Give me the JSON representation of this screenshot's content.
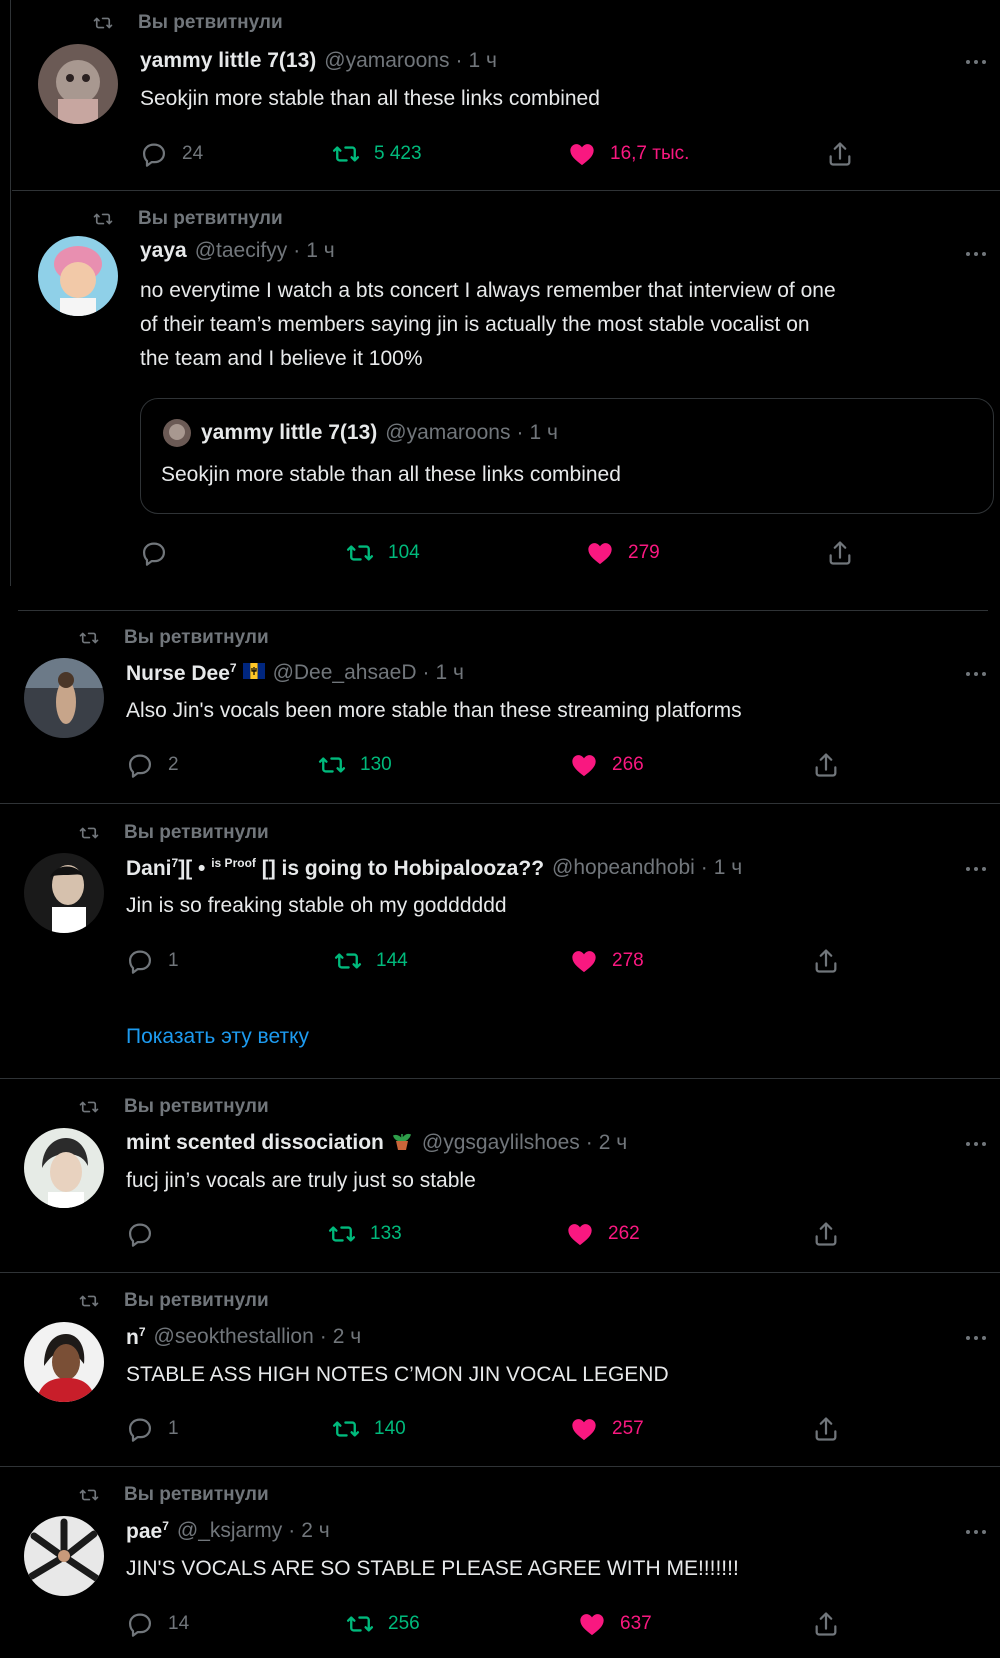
{
  "retweet_label": "Вы ретвитнули",
  "show_thread": "Показать эту ветку",
  "colors": {
    "retweet": "#00ba7c",
    "like": "#f91880",
    "muted": "#71767b",
    "link": "#1d9bf0"
  },
  "tweets": [
    {
      "name": "yammy little 7(13)",
      "handle": "@yamaroons",
      "time": "1 ч",
      "text": "Seokjin more stable than all these links combined",
      "replies": "24",
      "retweets": "5 423",
      "likes": "16,7 тыс."
    },
    {
      "name": "yaya",
      "handle": "@taecifyy",
      "time": "1 ч",
      "text_lines": [
        "no everytime I watch a bts concert I always remember that interview of one",
        "of their team’s members saying jin is actually the most stable vocalist on",
        "the team and I believe it 100%"
      ],
      "quote": {
        "name": "yammy little 7(13)",
        "handle": "@yamaroons",
        "time": "1 ч",
        "text": "Seokjin more stable than all these links combined"
      },
      "replies": "",
      "retweets": "104",
      "likes": "279"
    },
    {
      "name": "Nurse Dee",
      "name_sup": "7",
      "handle": "@Dee_ahsaeD",
      "time": "1 ч",
      "text": "Also Jin's vocals been more stable than these streaming platforms",
      "replies": "2",
      "retweets": "130",
      "likes": "266"
    },
    {
      "name": "Dani",
      "name_sup": "7",
      "name_rest": "][ • ",
      "name_sup2": "is Proof",
      "name_tail": " [] is going to Hobipalooza??",
      "handle": "@hopeandhobi",
      "time": "1 ч",
      "text": "Jin is so freaking stable oh my godddddd",
      "replies": "1",
      "retweets": "144",
      "likes": "278"
    },
    {
      "name": "mint scented dissociation",
      "name_emoji": "🪴",
      "handle": "@ygsgaylilshoes",
      "time": "2 ч",
      "text": "fucj jin’s vocals are truly just so stable",
      "replies": "",
      "retweets": "133",
      "likes": "262"
    },
    {
      "name": "n",
      "name_sup": "7",
      "handle": "@seokthestallion",
      "time": "2 ч",
      "text": "STABLE ASS HIGH NOTES C’MON JIN VOCAL LEGEND",
      "replies": "1",
      "retweets": "140",
      "likes": "257"
    },
    {
      "name": "pae",
      "name_sup": "7",
      "handle": "@_ksjarmy",
      "time": "2 ч",
      "text": "JIN'S VOCALS ARE SO STABLE PLEASE AGREE WITH ME!!!!!!!",
      "replies": "14",
      "retweets": "256",
      "likes": "637"
    }
  ]
}
